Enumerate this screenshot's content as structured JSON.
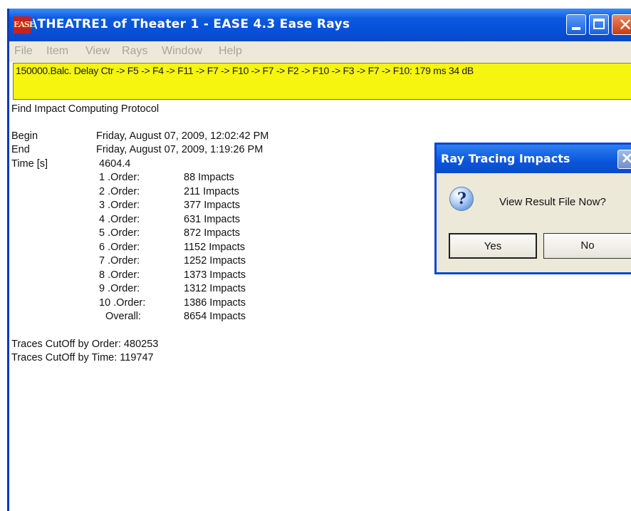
{
  "window": {
    "app_icon_text": "EASE",
    "title": "\\THEATRE1 of Theater 1 - EASE 4.3 Ease Rays",
    "menu": [
      "File",
      "Item",
      "View",
      "Rays",
      "Window",
      "Help"
    ]
  },
  "status_line": "150000.Balc. Delay Ctr -> F5 -> F4 -> F11 -> F7 -> F10 -> F7 -> F2 -> F10 -> F3 -> F7 -> F10: 179 ms 34 dB",
  "protocol": {
    "heading": "Find Impact Computing Protocol",
    "begin_label": "Begin",
    "begin_value": "Friday, August 07, 2009, 12:02:42 PM",
    "end_label": "End",
    "end_value": "Friday, August 07, 2009, 1:19:26 PM",
    "time_label": "Time [s]",
    "time_value": "4604.4",
    "orders": [
      {
        "label": "1 .Order:",
        "value": "88  Impacts"
      },
      {
        "label": "2 .Order:",
        "value": "211  Impacts"
      },
      {
        "label": "3 .Order:",
        "value": "377  Impacts"
      },
      {
        "label": "4 .Order:",
        "value": "631  Impacts"
      },
      {
        "label": "5 .Order:",
        "value": "872  Impacts"
      },
      {
        "label": "6 .Order:",
        "value": "1152  Impacts"
      },
      {
        "label": "7 .Order:",
        "value": "1252  Impacts"
      },
      {
        "label": "8 .Order:",
        "value": "1373  Impacts"
      },
      {
        "label": "9 .Order:",
        "value": "1312  Impacts"
      },
      {
        "label": "10 .Order:",
        "value": "1386  Impacts"
      }
    ],
    "overall_label": "Overall:",
    "overall_value": "8654  Impacts",
    "cutoff_order": "Traces CutOff by Order: 480253",
    "cutoff_time": "Traces CutOff by Time:  119747"
  },
  "dialog": {
    "title": "Ray Tracing Impacts",
    "message": "View Result File Now?",
    "yes_label": "Yes",
    "no_label": "No",
    "icon": "question-icon"
  },
  "colors": {
    "titlebar": "#0550d8",
    "status_bg": "#f5f50f",
    "dialog_bg": "#ece9d8"
  }
}
